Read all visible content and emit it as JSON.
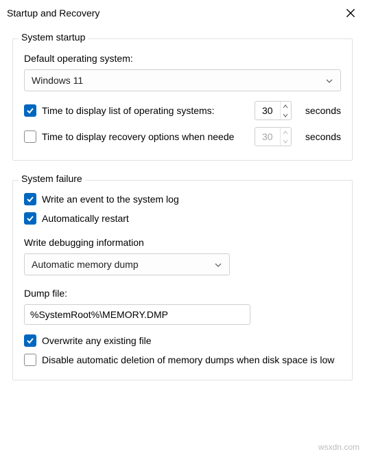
{
  "window": {
    "title": "Startup and Recovery"
  },
  "startup": {
    "legend": "System startup",
    "default_os_label": "Default operating system:",
    "default_os_value": "Windows 11",
    "display_list": {
      "checked": true,
      "label": "Time to display list of operating systems:",
      "value": "30",
      "unit": "seconds"
    },
    "recovery_options": {
      "checked": false,
      "label": "Time to display recovery options when needed:",
      "value": "30",
      "unit": "seconds"
    }
  },
  "failure": {
    "legend": "System failure",
    "write_event": {
      "checked": true,
      "label": "Write an event to the system log"
    },
    "auto_restart": {
      "checked": true,
      "label": "Automatically restart"
    },
    "debug_label": "Write debugging information",
    "debug_value": "Automatic memory dump",
    "dumpfile_label": "Dump file:",
    "dumpfile_value": "%SystemRoot%\\MEMORY.DMP",
    "overwrite": {
      "checked": true,
      "label": "Overwrite any existing file"
    },
    "disable_delete": {
      "checked": false,
      "label": "Disable automatic deletion of memory dumps when disk space is low"
    }
  },
  "watermark": "wsxdn.com"
}
